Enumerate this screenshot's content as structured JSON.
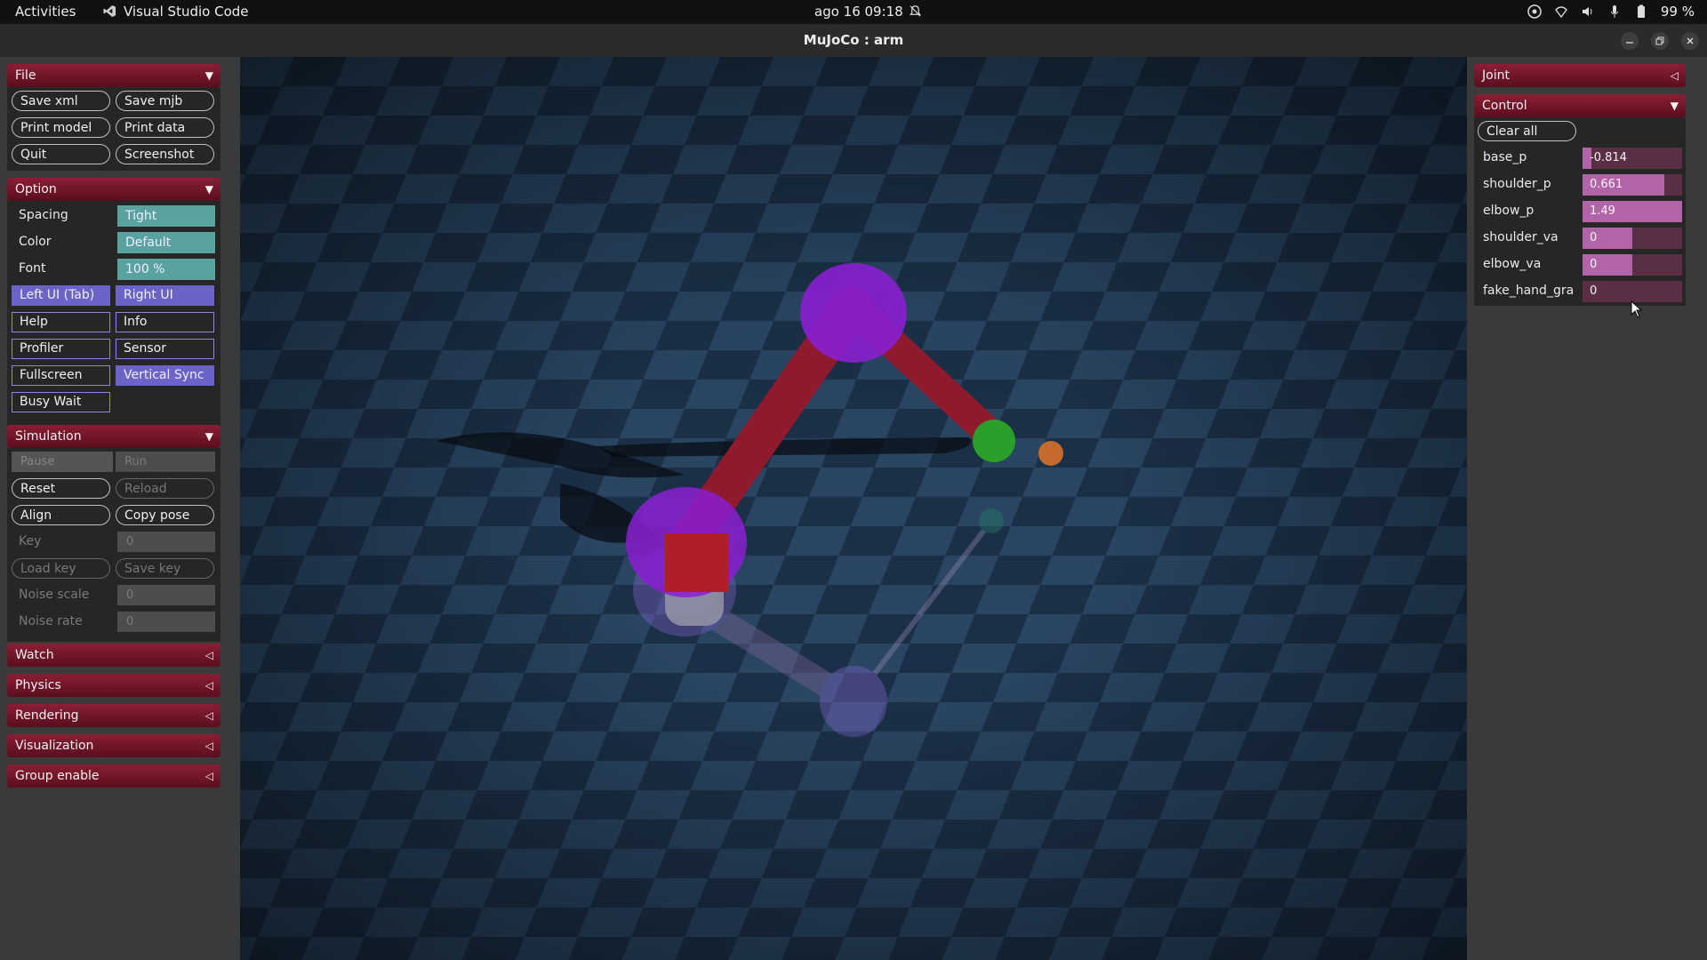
{
  "topbar": {
    "activities": "Activities",
    "app_name": "Visual Studio Code",
    "clock": "ago 16  09:18",
    "battery": "99 %"
  },
  "window": {
    "title": "MuJoCo : arm"
  },
  "left": {
    "file": {
      "header": "File",
      "buttons": [
        "Save xml",
        "Save mjb",
        "Print model",
        "Print data",
        "Quit",
        "Screenshot"
      ]
    },
    "option": {
      "header": "Option",
      "spacing_label": "Spacing",
      "spacing_value": "Tight",
      "color_label": "Color",
      "color_value": "Default",
      "font_label": "Font",
      "font_value": "100 %",
      "toggles": [
        "Left UI (Tab)",
        "Right UI",
        "Help",
        "Info",
        "Profiler",
        "Sensor",
        "Fullscreen",
        "Vertical Sync",
        "Busy Wait"
      ],
      "toggles_on": [
        true,
        true,
        false,
        false,
        false,
        false,
        false,
        true,
        false
      ]
    },
    "simulation": {
      "header": "Simulation",
      "pause": "Pause",
      "run": "Run",
      "reset": "Reset",
      "reload": "Reload",
      "align": "Align",
      "copy_pose": "Copy pose",
      "key_label": "Key",
      "key_value": "0",
      "load_key": "Load key",
      "save_key": "Save key",
      "noise_scale_label": "Noise scale",
      "noise_scale_value": "0",
      "noise_rate_label": "Noise rate",
      "noise_rate_value": "0"
    },
    "collapsed": [
      "Watch",
      "Physics",
      "Rendering",
      "Visualization",
      "Group enable"
    ]
  },
  "right": {
    "joint": {
      "header": "Joint"
    },
    "control": {
      "header": "Control",
      "clear_all": "Clear all",
      "sliders": [
        {
          "label": "base_p",
          "value": "-0.814",
          "fill": 0.09
        },
        {
          "label": "shoulder_p",
          "value": "0.661",
          "fill": 0.82
        },
        {
          "label": "elbow_p",
          "value": "1.49",
          "fill": 1.0
        },
        {
          "label": "shoulder_va",
          "value": "0",
          "fill": 0.5
        },
        {
          "label": "elbow_va",
          "value": "0",
          "fill": 0.5
        },
        {
          "label": "fake_hand_gra",
          "value": "0",
          "fill": 0.0
        }
      ]
    }
  },
  "colors": {
    "section_header": "#8a1f34",
    "select_teal": "#5aa29e",
    "toggle_on": "#6a64c8",
    "slider_fill": "#b165a8",
    "arm_red": "#8f1a2e",
    "joint_purple": "#8a1fd0"
  }
}
